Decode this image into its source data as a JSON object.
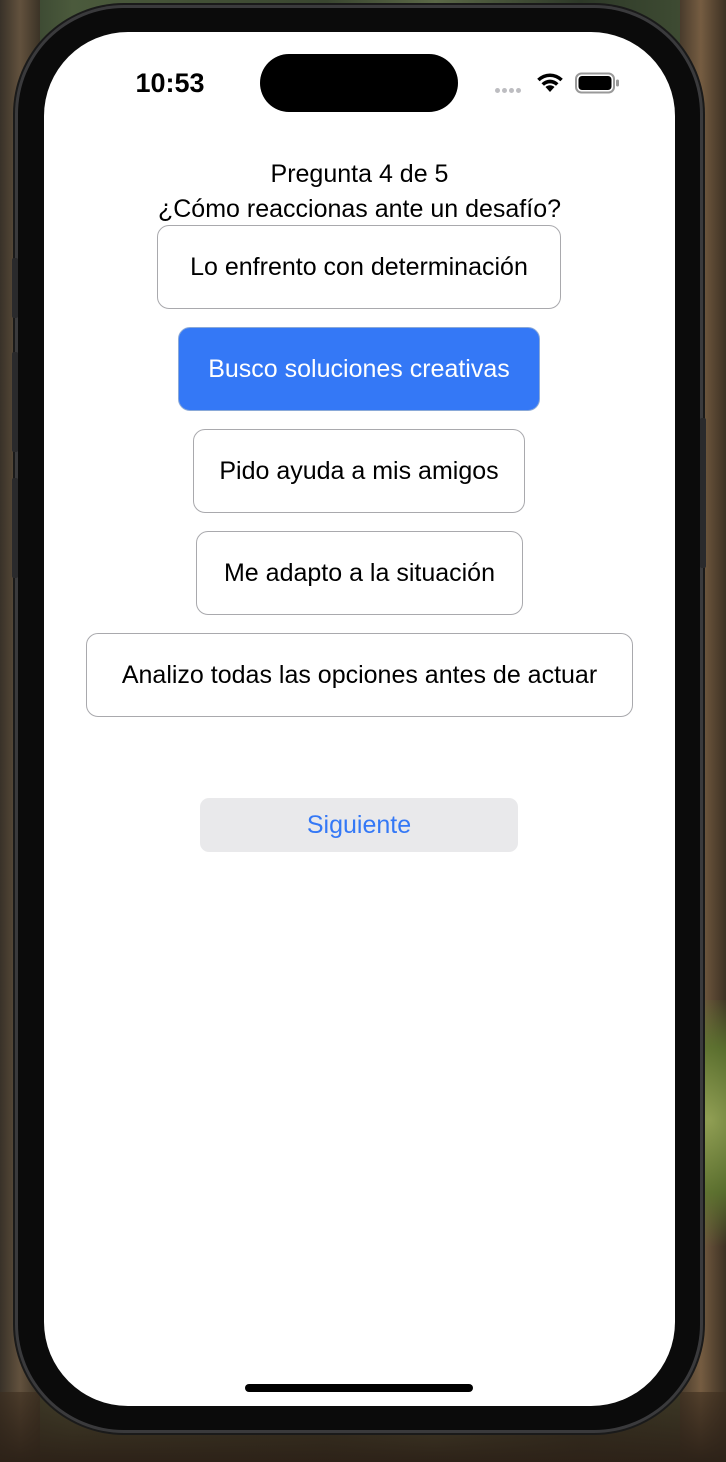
{
  "status_bar": {
    "time": "10:53"
  },
  "quiz": {
    "progress_label": "Pregunta 4 de 5",
    "question": "¿Cómo reaccionas ante un desafío?",
    "options": [
      {
        "label": "Lo enfrento con determinación",
        "selected": false
      },
      {
        "label": "Busco soluciones creativas",
        "selected": true
      },
      {
        "label": "Pido ayuda a mis amigos",
        "selected": false
      },
      {
        "label": "Me adapto a la situación",
        "selected": false
      },
      {
        "label": "Analizo todas las opciones antes de actuar",
        "selected": false
      }
    ],
    "next_label": "Siguiente"
  },
  "colors": {
    "accent": "#3478f6",
    "secondary_button_bg": "#e9e9eb",
    "option_border": "#a9a9ad"
  },
  "icons": [
    "wifi-icon",
    "battery-icon",
    "signal-icon"
  ]
}
